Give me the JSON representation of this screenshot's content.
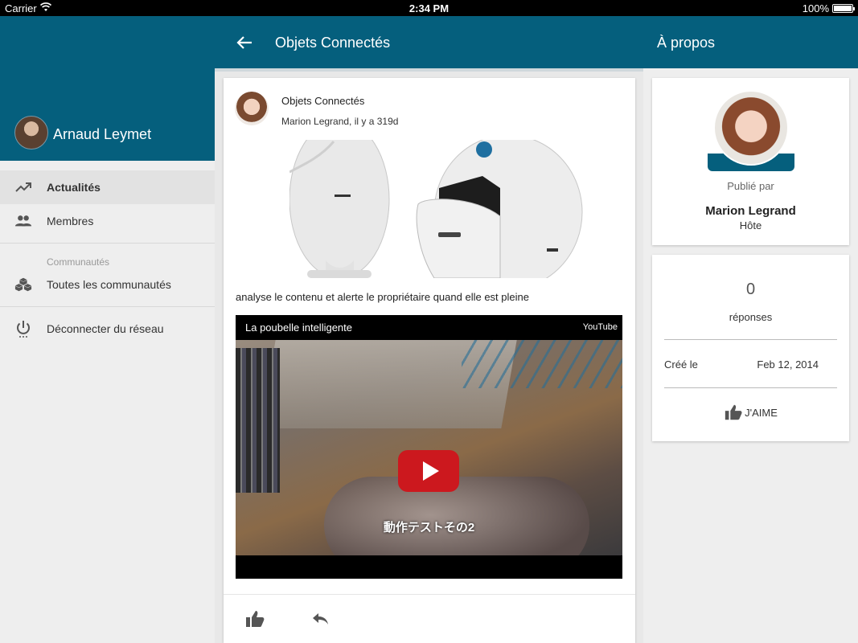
{
  "status_bar": {
    "carrier": "Carrier",
    "time": "2:34 PM",
    "battery": "100%"
  },
  "sidebar": {
    "user_name": "Arnaud Leymet",
    "items": [
      {
        "label": "Actualités",
        "icon": "trending-up-icon"
      },
      {
        "label": "Membres",
        "icon": "people-icon"
      }
    ],
    "section_title": "Communautés",
    "communities_item": {
      "label": "Toutes les communautés",
      "icon": "cubes-icon"
    },
    "logout_item": {
      "label": "Déconnecter du réseau",
      "icon": "power-icon"
    }
  },
  "header": {
    "title": "Objets Connectés",
    "right_title": "À propos"
  },
  "post": {
    "community": "Objets Connectés",
    "meta": "Marion Legrand, il y a 319d",
    "text": "analyse le contenu et alerte le propriétaire quand elle est pleine",
    "video": {
      "title": "La poubelle intelligente",
      "brand": "YouTube",
      "caption": "動作テストその2"
    }
  },
  "about": {
    "published_by": "Publié par",
    "author_name": "Marion Legrand",
    "author_role": "Hôte",
    "reply_count": "0",
    "reply_label": "réponses",
    "created_label": "Créé le",
    "created_date": "Feb 12, 2014",
    "like_label": "J'AIME"
  },
  "colors": {
    "primary": "#055f7d",
    "play_red": "#cc181e"
  }
}
